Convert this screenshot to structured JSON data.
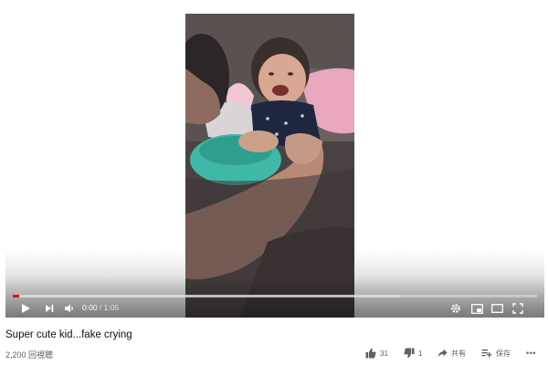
{
  "video": {
    "title": "Super cute kid...fake crying",
    "views": "2,200 回視聴"
  },
  "player": {
    "current_time": "0:00",
    "time_separator": "/",
    "duration": "1:05",
    "played_fraction": 0.012,
    "loaded_fraction": 0.74,
    "controls": [
      "play-icon",
      "next-icon",
      "volume-icon",
      "settings-icon",
      "miniplayer-icon",
      "theater-icon",
      "fullscreen-icon"
    ]
  },
  "actions": {
    "like_count": "31",
    "dislike_count": "1",
    "share_label": "共有",
    "save_label": "保存",
    "more_label": "•••"
  },
  "colors": {
    "progress_played": "#ff0000",
    "secondary_text": "#606060"
  }
}
